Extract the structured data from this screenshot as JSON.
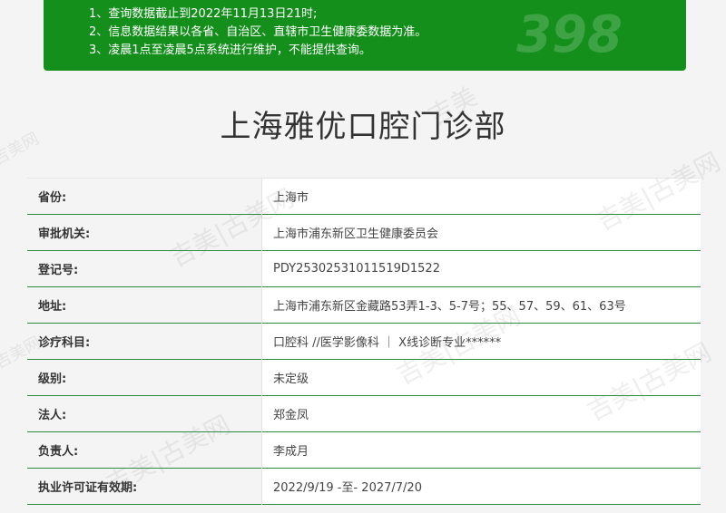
{
  "notice": {
    "lines": [
      "1、查询数据截止到2022年11月13日21时;",
      "2、信息数据结果以各省、自治区、直辖市卫生健康委数据为准。",
      "3、凌晨1点至凌晨5点系统进行维护，不能提供查询。"
    ],
    "background_color": "#148f1c"
  },
  "page_title": "上海雅优口腔门诊部",
  "records": [
    {
      "label": "省份:",
      "value": "上海市"
    },
    {
      "label": "审批机关:",
      "value": "上海市浦东新区卫生健康委员会"
    },
    {
      "label": "登记号:",
      "value": "PDY25302531011519D1522"
    },
    {
      "label": "地址:",
      "value": "上海市浦东新区金藏路53弄1-3、5-7号；55、57、59、61、63号"
    },
    {
      "label": "诊疗科目:",
      "value": "口腔科 //医学影像科 ｜ X线诊断专业******"
    },
    {
      "label": "级别:",
      "value": "未定级"
    },
    {
      "label": "法人:",
      "value": "郑金凤"
    },
    {
      "label": "负责人:",
      "value": "李成月"
    },
    {
      "label": "执业许可证有效期:",
      "value": "2022/9/19 -至- 2027/7/20"
    }
  ],
  "watermarks": [
    "吉美",
    "吉美网",
    "吉美|古美网"
  ],
  "colors": {
    "accent": "#148f1c",
    "row_border": "#2d8c3a",
    "label_bg": "#f4f4f4"
  }
}
